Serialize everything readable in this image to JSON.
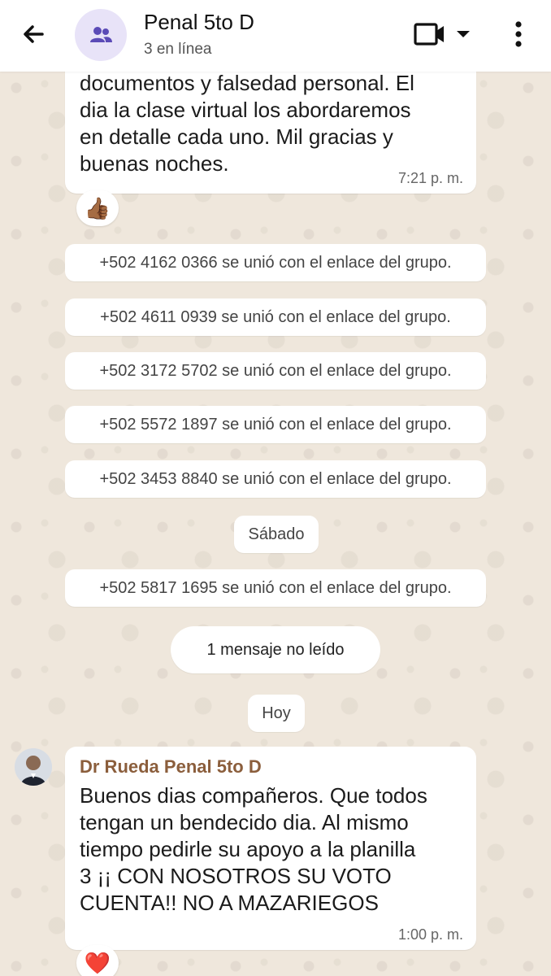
{
  "header": {
    "title": "Penal 5to D",
    "subtitle": "3 en línea",
    "icons": {
      "back": "arrow-left-icon",
      "group": "group-icon",
      "video": "video-camera-icon",
      "dropdown": "chevron-down-icon",
      "more": "more-vertical-icon"
    }
  },
  "messages": {
    "first": {
      "text": "documentos y falsedad personal. El\ndia la clase virtual los abordaremos\nen detalle cada uno. Mil gracias y\nbuenas noches.",
      "time": "7:21 p. m.",
      "reaction": "👍🏾"
    },
    "system": [
      "+502 4162 0366 se unió con el enlace del grupo.",
      "+502 4611 0939 se unió con el enlace del grupo.",
      "+502 3172 5702 se unió con el enlace del grupo.",
      "+502 5572 1897 se unió con el enlace del grupo.",
      "+502 3453 8840 se unió con el enlace del grupo."
    ],
    "date_sabado": "Sábado",
    "system_after": "+502 5817 1695 se unió con el enlace del grupo.",
    "unread": "1 mensaje no leído",
    "date_hoy": "Hoy",
    "last": {
      "sender": "Dr Rueda Penal 5to D",
      "text": "Buenos dias compañeros. Que todos\ntengan un bendecido dia. Al mismo\ntiempo pedirle su apoyo a la planilla\n3 ¡¡ CON NOSOTROS SU VOTO\nCUENTA!! NO A MAZARIEGOS",
      "time": "1:00 p. m.",
      "reaction": "❤️"
    }
  },
  "colors": {
    "sender_name": "#8b5e3c",
    "accent_avatar_bg": "#e8e3f8",
    "chat_bg": "#efe7dc"
  }
}
